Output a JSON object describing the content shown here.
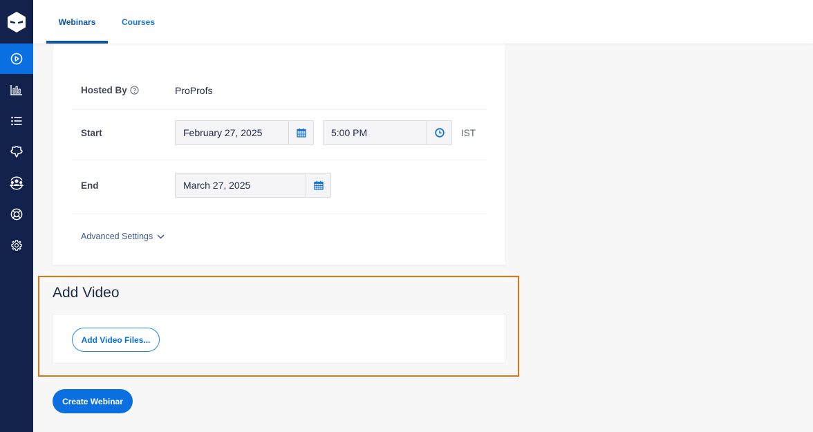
{
  "sidebar": {
    "logo_icon": "proprofs-logo-icon",
    "items": [
      {
        "name": "webinars",
        "icon": "play-circle-icon",
        "active": true
      },
      {
        "name": "reports",
        "icon": "bar-chart-icon",
        "active": false
      },
      {
        "name": "list",
        "icon": "list-icon",
        "active": false
      },
      {
        "name": "integrations",
        "icon": "puzzle-icon",
        "active": false
      },
      {
        "name": "users",
        "icon": "users-group-icon",
        "active": false
      },
      {
        "name": "help",
        "icon": "lifebuoy-icon",
        "active": false
      },
      {
        "name": "settings",
        "icon": "gear-icon",
        "active": false
      }
    ]
  },
  "header": {
    "tabs": [
      {
        "label": "Webinars",
        "active": true
      },
      {
        "label": "Courses",
        "active": false
      }
    ]
  },
  "form": {
    "hosted_by": {
      "label": "Hosted By",
      "value": "ProProfs",
      "help_icon": "question-circle-icon"
    },
    "start": {
      "label": "Start",
      "date": "February 27, 2025",
      "time": "5:00 PM",
      "timezone": "IST"
    },
    "end": {
      "label": "End",
      "date": "March 27, 2025"
    },
    "advanced_settings_label": "Advanced Settings"
  },
  "add_video": {
    "title": "Add Video",
    "button_label": "Add Video Files..."
  },
  "actions": {
    "create_label": "Create Webinar"
  },
  "colors": {
    "sidebar": "#13214d",
    "accent": "#0a6fe0",
    "highlight": "#dd7411"
  }
}
